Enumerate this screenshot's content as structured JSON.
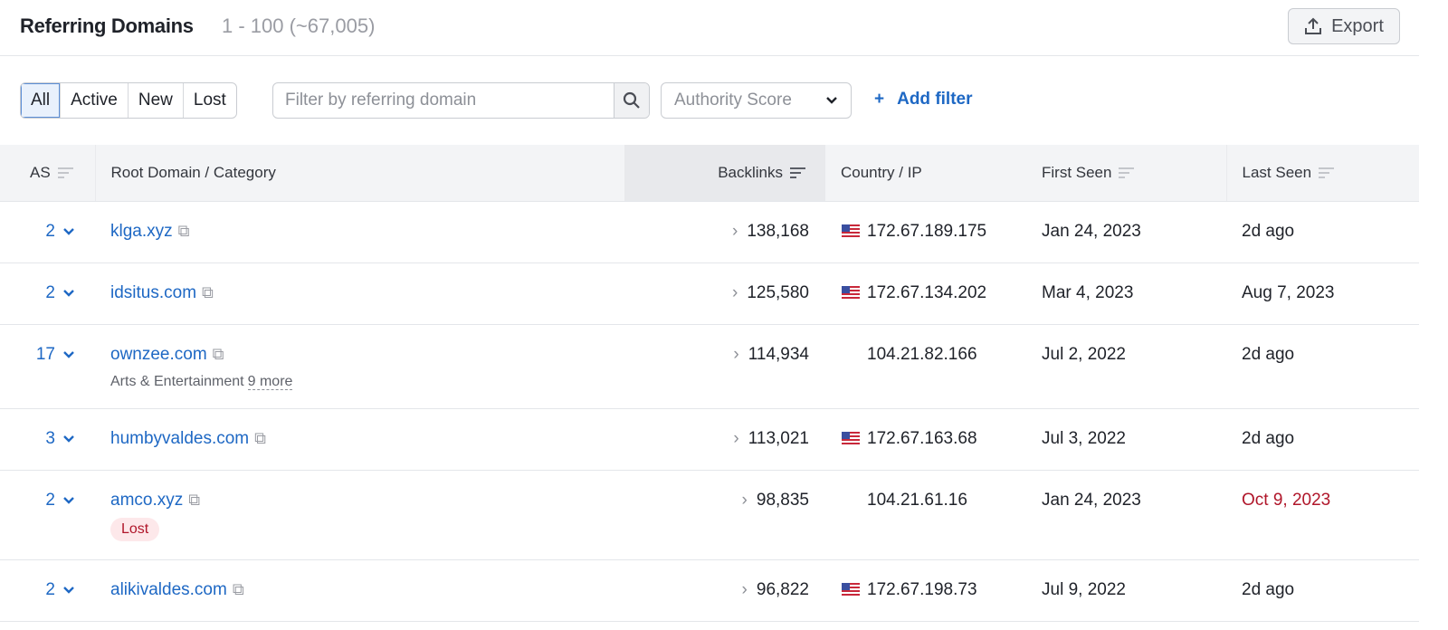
{
  "header": {
    "title": "Referring Domains",
    "count": "1 - 100 (~67,005)",
    "export_label": "Export"
  },
  "filters": {
    "segments": [
      "All",
      "Active",
      "New",
      "Lost"
    ],
    "search_placeholder": "Filter by referring domain",
    "authority_score_label": "Authority Score",
    "add_filter_label": "Add filter"
  },
  "columns": [
    "AS",
    "Root Domain / Category",
    "Backlinks",
    "Country / IP",
    "First Seen",
    "Last Seen"
  ],
  "rows": [
    {
      "as": "2",
      "domain": "klga.xyz",
      "category": "",
      "more": "",
      "badge": "",
      "backlinks": "138,168",
      "flag": true,
      "ip": "172.67.189.175",
      "first_seen": "Jan 24, 2023",
      "last_seen": "2d ago",
      "last_lost": false
    },
    {
      "as": "2",
      "domain": "idsitus.com",
      "category": "",
      "more": "",
      "badge": "",
      "backlinks": "125,580",
      "flag": true,
      "ip": "172.67.134.202",
      "first_seen": "Mar 4, 2023",
      "last_seen": "Aug 7, 2023",
      "last_lost": false
    },
    {
      "as": "17",
      "domain": "ownzee.com",
      "category": "Arts & Entertainment",
      "more": "9 more",
      "badge": "",
      "backlinks": "114,934",
      "flag": false,
      "ip": "104.21.82.166",
      "first_seen": "Jul 2, 2022",
      "last_seen": "2d ago",
      "last_lost": false
    },
    {
      "as": "3",
      "domain": "humbyvaldes.com",
      "category": "",
      "more": "",
      "badge": "",
      "backlinks": "113,021",
      "flag": true,
      "ip": "172.67.163.68",
      "first_seen": "Jul 3, 2022",
      "last_seen": "2d ago",
      "last_lost": false
    },
    {
      "as": "2",
      "domain": "amco.xyz",
      "category": "",
      "more": "",
      "badge": "Lost",
      "backlinks": "98,835",
      "flag": false,
      "ip": "104.21.61.16",
      "first_seen": "Jan 24, 2023",
      "last_seen": "Oct 9, 2023",
      "last_lost": true
    },
    {
      "as": "2",
      "domain": "alikivaldes.com",
      "category": "",
      "more": "",
      "badge": "",
      "backlinks": "96,822",
      "flag": true,
      "ip": "172.67.198.73",
      "first_seen": "Jul 9, 2022",
      "last_seen": "2d ago",
      "last_lost": false
    }
  ]
}
